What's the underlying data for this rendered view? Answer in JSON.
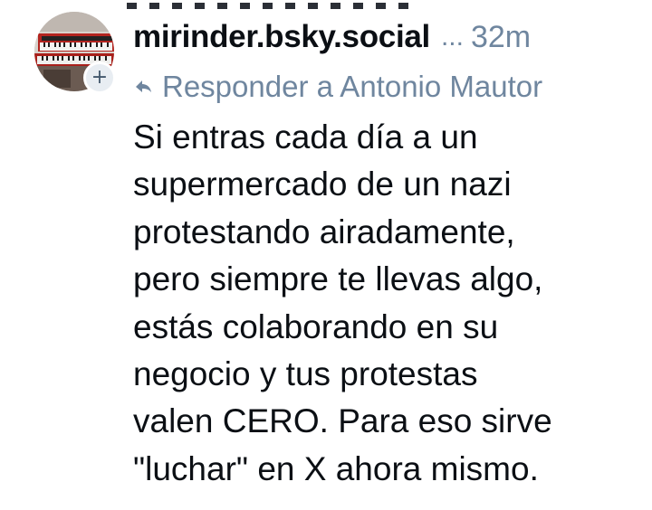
{
  "post": {
    "author_handle": "mirinder.bsky.social",
    "ellipsis": "...",
    "timestamp": "32m",
    "reply_label": "Responder a Antonio Mautor",
    "body_lines": [
      "Si entras cada día a un",
      "supermercado de un nazi",
      "protestando airadamente,",
      "pero siempre te llevas algo,",
      "estás colaborando en su",
      "negocio y tus protestas",
      "valen CERO. Para eso sirve",
      "\"luchar\" en X ahora mismo."
    ],
    "follow_badge": "+",
    "avatar_icon": "keyboard-instrument-photo",
    "reply_icon": "reply-arrow-icon"
  },
  "colors": {
    "text": "#0b0f14",
    "muted": "#6f869f",
    "badge_bg": "#e8edf2",
    "background": "#ffffff"
  }
}
